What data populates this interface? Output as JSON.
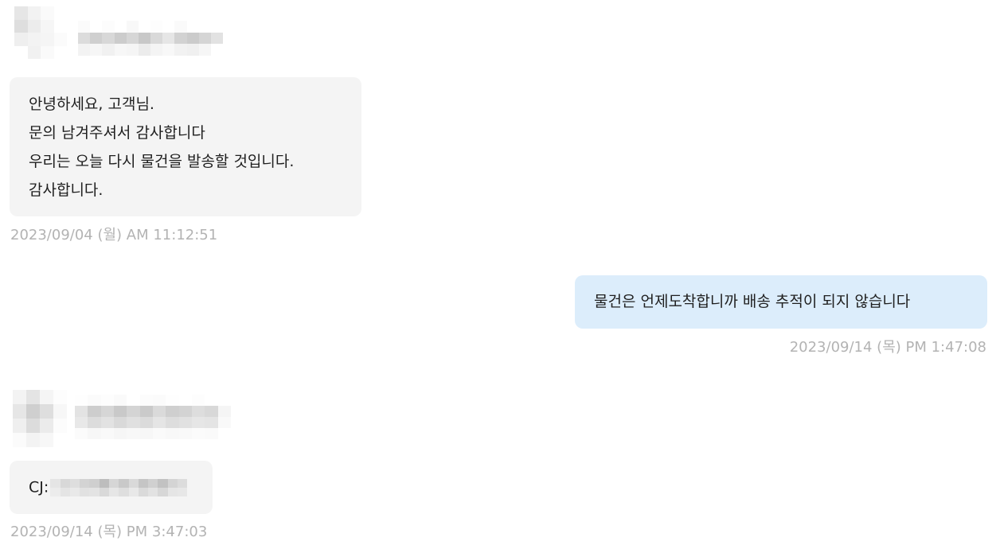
{
  "conversation": {
    "messages": [
      {
        "direction": "incoming",
        "lines": [
          "안녕하세요, 고객님.",
          "문의 남겨주셔서 감사합니다",
          "우리는 오늘 다시 물건을 발송할 것입니다.",
          "감사합니다."
        ],
        "timestamp": "2023/09/04 (월) AM 11:12:51"
      },
      {
        "direction": "outgoing",
        "text": "물건은 언제도착합니까 배송 추적이 되지 않습니다",
        "timestamp": "2023/09/14 (목) PM 1:47:08"
      },
      {
        "direction": "incoming",
        "text_prefix": "CJ:",
        "timestamp": "2023/09/14 (목) PM 3:47:03"
      }
    ]
  },
  "colors": {
    "incoming_bubble": "#f4f4f4",
    "outgoing_bubble": "#dcedfb",
    "timestamp_text": "#b3b3b3",
    "message_text": "#1f1f1f"
  },
  "redaction_palettes": {
    "avatar_1": [
      "#e6e6e6",
      "#f2f2f2",
      "#fafafa",
      "#ffffff",
      "#dedede",
      "#ececec",
      "#f6f6f6",
      "#ffffff",
      "#efefef",
      "#f3f3f3",
      "#f5f5f5",
      "#fbfbfb",
      "#ffffff",
      "#f1f1f1",
      "#fafafa",
      "#ffffff"
    ],
    "name_1": [
      "#fbfbfb",
      "#ffffff",
      "#fcfcfc",
      "#ffffff",
      "#f8f8f8",
      "#ffffff",
      "#fdfdfd",
      "#ffffff",
      "#fafafa",
      "#ffffff",
      "#ffffff",
      "#ffffff",
      "#dcdcdc",
      "#cfcfcf",
      "#d8d8d8",
      "#cccccc",
      "#d6d6d6",
      "#c8c8c8",
      "#d9d9d9",
      "#e6e6e6",
      "#d2d2d2",
      "#cbcbcb",
      "#d5d5d5",
      "#e2e2e2",
      "#f3f3f3",
      "#f6f6f6",
      "#f1f1f1",
      "#f7f7f7",
      "#f5f5f5",
      "#ececec",
      "#f4f4f4",
      "#f8f8f8",
      "#f2f2f2",
      "#f0f0f0",
      "#f6f6f6",
      "#ffffff"
    ],
    "avatar_2": [
      "#f3f3f3",
      "#e4e4e4",
      "#f5f5f5",
      "#fdfdfd",
      "#e6e6e6",
      "#cfcfcf",
      "#dedede",
      "#f7f7f7",
      "#efefef",
      "#dcdcdc",
      "#ebebeb",
      "#fcfcfc",
      "#fbfbfb",
      "#f3f3f3",
      "#f7f7f7",
      "#ffffff"
    ],
    "name_2": [
      "#fefefe",
      "#fbfbfb",
      "#fdfdfd",
      "#fafafa",
      "#ffffff",
      "#fcfcfc",
      "#fbfbfb",
      "#fefefe",
      "#ffffff",
      "#fdfdfd",
      "#ffffff",
      "#ffffff",
      "#e3e3e3",
      "#cdcdcd",
      "#d6d6d6",
      "#c9c9c9",
      "#d4d4d4",
      "#cacaca",
      "#dadada",
      "#cfcfcf",
      "#d3d3d3",
      "#dddddd",
      "#d8d8d8",
      "#f5f5f5",
      "#e8e8e8",
      "#dcdcdc",
      "#e2e2e2",
      "#d9d9d9",
      "#e0e0e0",
      "#dbdbdb",
      "#e5e5e5",
      "#dddddd",
      "#e1e1e1",
      "#e6e6e6",
      "#e4e4e4",
      "#f9f9f9",
      "#fbfbfb",
      "#f7f7f7",
      "#f9f9f9",
      "#f6f6f6",
      "#f8f8f8",
      "#f7f7f7",
      "#fafafa",
      "#f8f8f8",
      "#f9f9f9",
      "#fbfbfb",
      "#fafafa",
      "#ffffff"
    ],
    "cj_value": [
      "#e5e5e5",
      "#d8d8d8",
      "#dedede",
      "#d3d3d3",
      "#cfcfcf",
      "#bdbdbd",
      "#d6d6d6",
      "#c9c9c9",
      "#d9d9d9",
      "#c5c5c5",
      "#d0d0d0",
      "#c2c2c2",
      "#d4d4d4",
      "#dcdcdc",
      "#ececec",
      "#e4e4e4",
      "#e9e9e9",
      "#e1e1e1",
      "#e3e3e3",
      "#d9d9d9",
      "#e6e6e6",
      "#dedede",
      "#e8e8e8",
      "#dadada",
      "#e2e2e2",
      "#d7d7d7",
      "#e5e5e5",
      "#e7e7e7"
    ]
  }
}
